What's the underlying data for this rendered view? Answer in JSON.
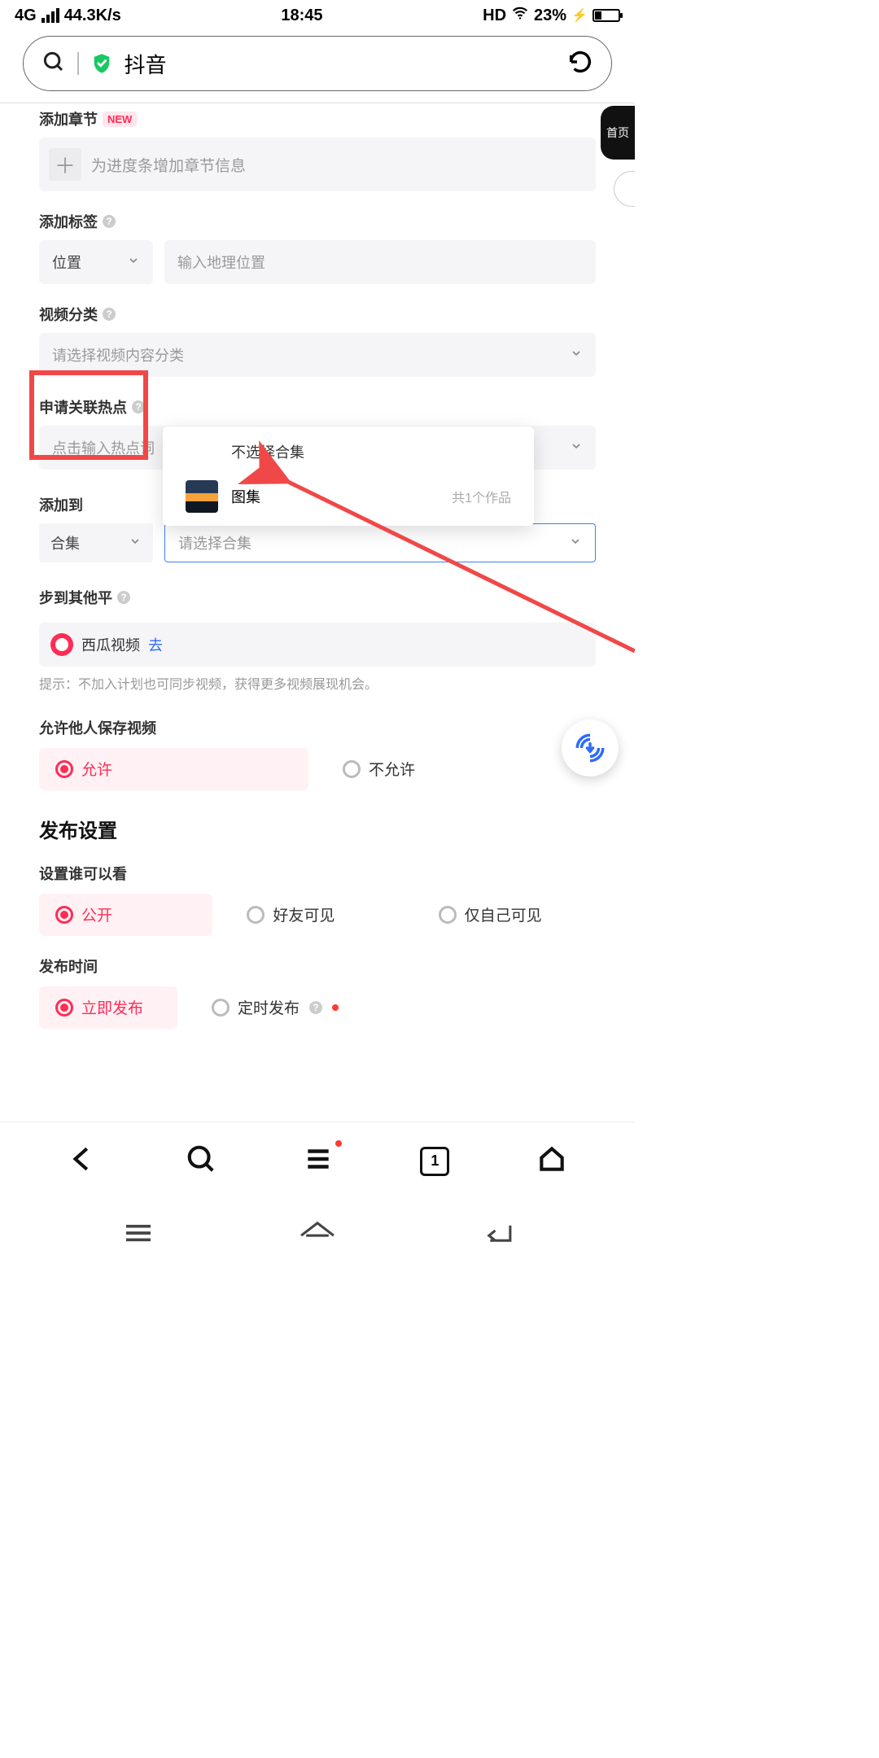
{
  "status": {
    "net": "4G",
    "speed": "44.3K/s",
    "time": "18:45",
    "hd": "HD",
    "battery": "23%"
  },
  "search": {
    "text": "抖音"
  },
  "chapter": {
    "label": "添加章节",
    "new": "NEW",
    "placeholder": "为进度条增加章节信息"
  },
  "tags": {
    "label": "添加标签",
    "select": "位置",
    "geo_ph": "输入地理位置"
  },
  "category": {
    "label": "视频分类",
    "ph": "请选择视频内容分类"
  },
  "hotspot": {
    "label": "申请关联热点",
    "ph": "点击输入热点词"
  },
  "addto": {
    "label": "添加到",
    "small": "合集",
    "select_ph": "请选择合集"
  },
  "dropdown": {
    "none": "不选择合集",
    "item1_name": "图集",
    "item1_meta": "共1个作品"
  },
  "sync": {
    "label_partial": "步到其他平",
    "xigua": "西瓜视频",
    "go": "去",
    "hint": "提示：不加入计划也可同步视频，获得更多视频展现机会。"
  },
  "save": {
    "label": "允许他人保存视频",
    "allow": "允许",
    "deny": "不允许"
  },
  "publish": {
    "title": "发布设置",
    "who_label": "设置谁可以看",
    "public": "公开",
    "friends": "好友可见",
    "self": "仅自己可见",
    "time_label": "发布时间",
    "now": "立即发布",
    "scheduled": "定时发布"
  },
  "dark_pill": "首页",
  "browser": {
    "tabs": "1"
  }
}
